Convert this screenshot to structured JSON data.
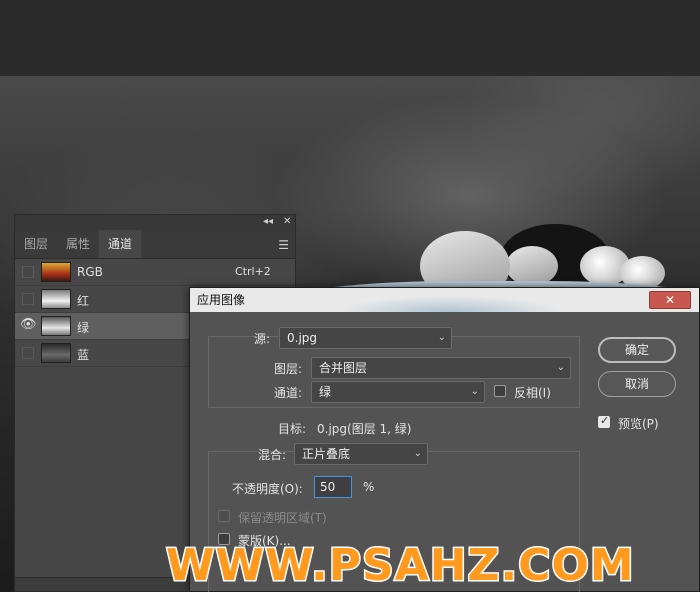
{
  "panel": {
    "tabs": [
      {
        "label": "图层"
      },
      {
        "label": "属性"
      },
      {
        "label": "通道"
      }
    ],
    "collapse_icon": "double-chevron",
    "close_icon": "close",
    "menu_icon": "hamburger",
    "channels": [
      {
        "name": "RGB",
        "shortcut": "Ctrl+2",
        "visible": false,
        "selected": false
      },
      {
        "name": "红",
        "shortcut": "",
        "visible": false,
        "selected": false
      },
      {
        "name": "绿",
        "shortcut": "",
        "visible": true,
        "selected": true
      },
      {
        "name": "蓝",
        "shortcut": "",
        "visible": false,
        "selected": false
      }
    ]
  },
  "dialog": {
    "title": "应用图像",
    "close_glyph": "✕",
    "source_label": "源:",
    "source_value": "0.jpg",
    "layer_label": "图层:",
    "layer_value": "合并图层",
    "channel_label": "通道:",
    "channel_value": "绿",
    "invert_label": "反相(I)",
    "invert_checked": false,
    "target_label": "目标:",
    "target_value": "0.jpg(图层 1, 绿)",
    "blend_label": "混合:",
    "blend_value": "正片叠底",
    "opacity_label": "不透明度(O):",
    "opacity_value": "50",
    "opacity_unit": "%",
    "preserve_label": "保留透明区域(T)",
    "mask_label": "蒙版(K)...",
    "ok_label": "确定",
    "cancel_label": "取消",
    "preview_label": "预览(P)",
    "preview_checked": true
  },
  "watermark": "WWW.PSAHZ.COM"
}
